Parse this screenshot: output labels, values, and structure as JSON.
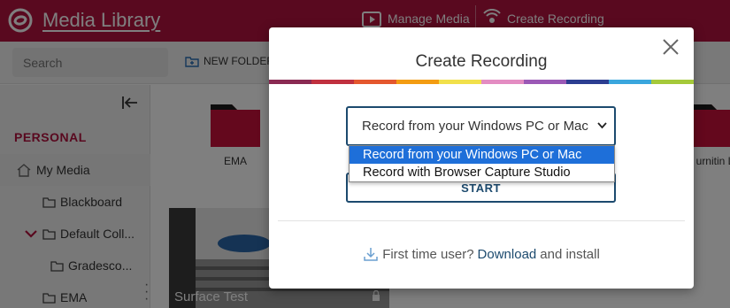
{
  "app": {
    "title": "Media Library"
  },
  "topnav": {
    "manage_media": "Manage Media",
    "create_recording": "Create Recording"
  },
  "toolbar": {
    "search_placeholder": "Search",
    "new_folder": "NEW FOLDER"
  },
  "sidebar": {
    "section": "PERSONAL",
    "items": [
      {
        "label": "My Media",
        "icon": "home-icon"
      },
      {
        "label": "Blackboard",
        "icon": "folder-icon"
      },
      {
        "label": "Default Coll...",
        "icon": "folder-icon"
      },
      {
        "label": "Gradesco...",
        "icon": "folder-icon"
      },
      {
        "label": "EMA",
        "icon": "folder-icon"
      }
    ]
  },
  "main": {
    "folders": [
      {
        "label": "EMA"
      },
      {
        "label": "urnitin L"
      }
    ],
    "video": {
      "title": "Surface Test"
    }
  },
  "modal": {
    "title": "Create Recording",
    "select_value": "Record from your Windows PC or Mac",
    "options": [
      "Record from your Windows PC or Mac",
      "Record with Browser Capture Studio"
    ],
    "start": "START",
    "footer": {
      "prefix": "First time user?",
      "link": "Download",
      "suffix": "and install"
    }
  },
  "colors": {
    "brand": "#b3123f",
    "accent": "#1c4a6e",
    "selection": "#1e6fd9",
    "rainbow": [
      "#8a2a52",
      "#c0303f",
      "#e4572e",
      "#f39c12",
      "#f1e04b",
      "#e38cc2",
      "#9b59b6",
      "#2c3e91",
      "#3aa6dd",
      "#a5c93a"
    ]
  }
}
